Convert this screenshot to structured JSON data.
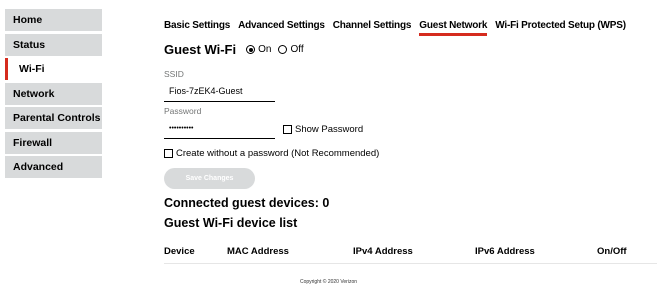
{
  "sidebar": {
    "items": [
      {
        "label": "Home"
      },
      {
        "label": "Status"
      },
      {
        "label": "Wi-Fi"
      },
      {
        "label": "Network"
      },
      {
        "label": "Parental Controls"
      },
      {
        "label": "Firewall"
      },
      {
        "label": "Advanced"
      }
    ],
    "active": "Wi-Fi"
  },
  "tabs": [
    {
      "label": "Basic Settings"
    },
    {
      "label": "Advanced Settings"
    },
    {
      "label": "Channel Settings"
    },
    {
      "label": "Guest Network"
    },
    {
      "label": "Wi-Fi Protected Setup (WPS)"
    }
  ],
  "active_tab": "Guest Network",
  "guest_wifi": {
    "title": "Guest Wi-Fi",
    "on_label": "On",
    "off_label": "Off",
    "selected": "On"
  },
  "ssid": {
    "label": "SSID",
    "value": "Fios-7zEK4-Guest"
  },
  "password": {
    "label": "Password",
    "value": "••••••••••",
    "show_label": "Show Password"
  },
  "no_password_label": "Create without a password (Not Recommended)",
  "save_label": "Save Changes",
  "connected_label": "Connected guest devices: 0",
  "device_list_title": "Guest Wi-Fi device list",
  "table": {
    "columns": [
      "Device",
      "MAC Address",
      "IPv4 Address",
      "IPv6 Address",
      "On/Off"
    ]
  },
  "footer": "Copyright © 2020 Verizon",
  "colors": {
    "accent": "#d52b1e",
    "nav_bg": "#d8dadb",
    "button_disabled": "#d8dadb"
  }
}
